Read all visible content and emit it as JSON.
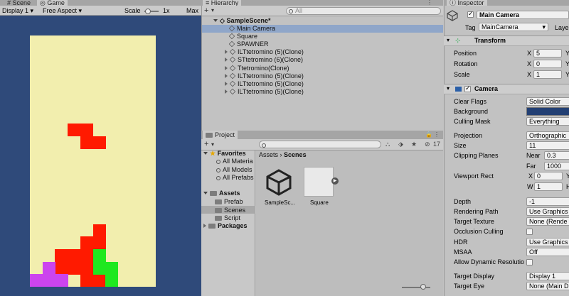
{
  "tabs": {
    "scene": "Scene",
    "game": "Game",
    "hierarchy": "Hierarchy",
    "inspector": "Inspector",
    "project": "Project"
  },
  "game_toolbar": {
    "display": "Display 1",
    "aspect": "Free Aspect",
    "scale_label": "Scale",
    "scale_value": "1x",
    "maximize": "Max"
  },
  "hierarchy": {
    "add": "+",
    "search_placeholder": "All",
    "scene_name": "SampleScene*",
    "items": [
      {
        "label": "Main Camera",
        "expandable": false,
        "selected": true
      },
      {
        "label": "Square",
        "expandable": false,
        "selected": false
      },
      {
        "label": "SPAWNER",
        "expandable": false,
        "selected": false
      },
      {
        "label": "ILTtetromino (5)(Clone)",
        "expandable": true,
        "selected": false
      },
      {
        "label": "STtetromino (6)(Clone)",
        "expandable": true,
        "selected": false
      },
      {
        "label": "Ttetromino(Clone)",
        "expandable": true,
        "selected": false
      },
      {
        "label": "ILTtetromino (5)(Clone)",
        "expandable": true,
        "selected": false
      },
      {
        "label": "ILTtetromino (5)(Clone)",
        "expandable": true,
        "selected": false
      },
      {
        "label": "ILTtetromino (5)(Clone)",
        "expandable": true,
        "selected": false
      }
    ]
  },
  "project": {
    "add": "+",
    "count": "17",
    "sidebar": {
      "favorites": "Favorites",
      "fav_items": [
        "All Materia",
        "All Models",
        "All Prefabs"
      ],
      "assets": "Assets",
      "asset_items": [
        "Prefab",
        "Scenes",
        "Script"
      ],
      "packages": "Packages"
    },
    "breadcrumb": {
      "root": "Assets",
      "current": "Scenes"
    },
    "files": [
      {
        "label": "SampleSc...",
        "icon": "unity-logo-icon"
      },
      {
        "label": "Square",
        "icon": "sprite-square-icon"
      }
    ]
  },
  "inspector": {
    "object_name": "Main Camera",
    "tag_label": "Tag",
    "tag_value": "MainCamera",
    "layer_label": "Laye",
    "transform": {
      "title": "Transform",
      "rows": [
        {
          "label": "Position",
          "axis": "X",
          "value": "5",
          "next_axis": "Y"
        },
        {
          "label": "Rotation",
          "axis": "X",
          "value": "0",
          "next_axis": "Y"
        },
        {
          "label": "Scale",
          "axis": "X",
          "value": "1",
          "next_axis": "Y"
        }
      ]
    },
    "camera": {
      "title": "Camera",
      "clear_flags": {
        "label": "Clear Flags",
        "value": "Solid Color"
      },
      "background": {
        "label": "Background",
        "color": "#223f73"
      },
      "culling_mask": {
        "label": "Culling Mask",
        "value": "Everything"
      },
      "projection": {
        "label": "Projection",
        "value": "Orthographic"
      },
      "size": {
        "label": "Size",
        "value": "11"
      },
      "clipping": {
        "label": "Clipping Planes",
        "near_label": "Near",
        "near": "0.3",
        "far_label": "Far",
        "far": "1000"
      },
      "viewport": {
        "label": "Viewport Rect",
        "x_label": "X",
        "x": "0",
        "w_label": "W",
        "w": "1",
        "y_label": "Y",
        "h_label": "H"
      },
      "depth": {
        "label": "Depth",
        "value": "-1"
      },
      "rendering_path": {
        "label": "Rendering Path",
        "value": "Use Graphics"
      },
      "target_texture": {
        "label": "Target Texture",
        "value": "None (Rende"
      },
      "occlusion": {
        "label": "Occlusion Culling"
      },
      "hdr": {
        "label": "HDR",
        "value": "Use Graphics"
      },
      "msaa": {
        "label": "MSAA",
        "value": "Off"
      },
      "dynamic_res": {
        "label": "Allow Dynamic Resolutio"
      },
      "target_display": {
        "label": "Target Display",
        "value": "Display 1"
      },
      "target_eye": {
        "label": "Target Eye",
        "value": "None (Main D"
      }
    }
  },
  "colors": {
    "game_bg": "#2f4a7a",
    "board": "#f2eeae",
    "red": "#ff1a00",
    "green": "#1fe81f",
    "purple": "#cc44ee",
    "selection": "#8fa6c9"
  }
}
